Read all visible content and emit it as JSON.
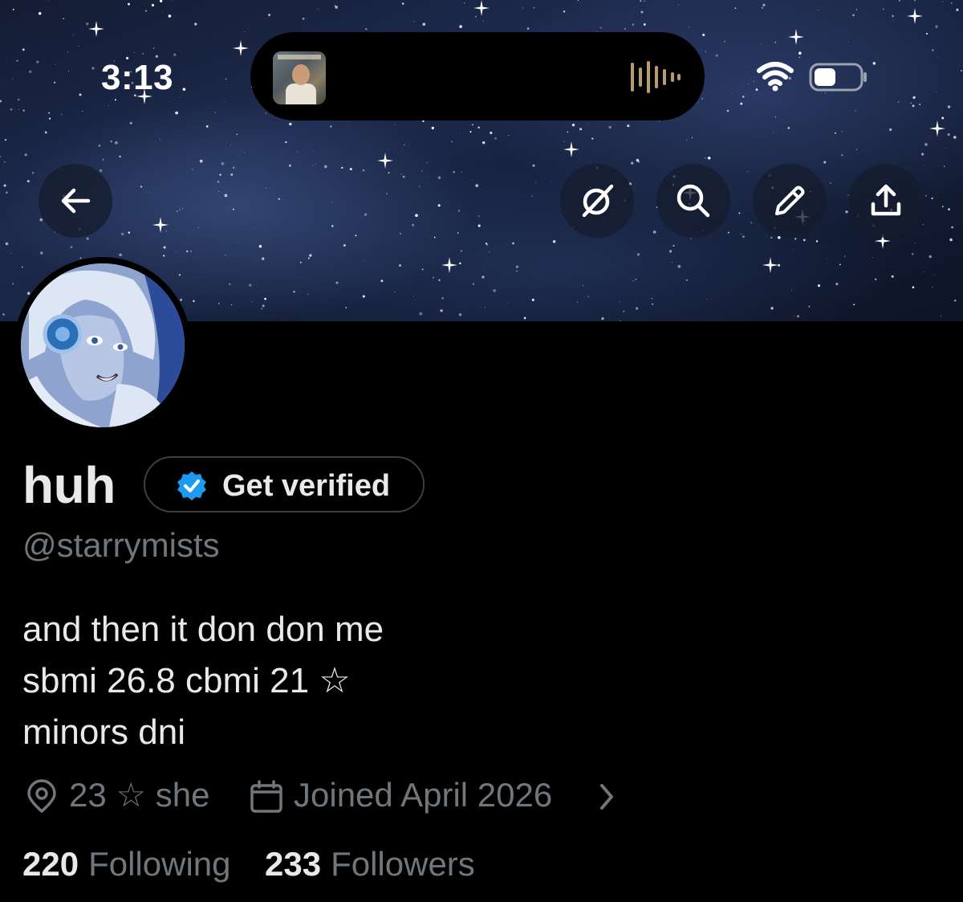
{
  "status_bar": {
    "time": "3:13",
    "now_playing_icon": "album-art-icon",
    "audio_icon": "waveform-icon",
    "wifi_icon": "wifi-icon",
    "battery_icon": "battery-icon"
  },
  "nav": {
    "back_icon": "back-arrow-icon",
    "actions": [
      {
        "name": "grok-icon"
      },
      {
        "name": "search-icon"
      },
      {
        "name": "edit-icon"
      },
      {
        "name": "share-icon"
      }
    ]
  },
  "profile": {
    "display_name": "huh",
    "verify_label": "Get verified",
    "handle": "@starrymists",
    "bio_lines": [
      "and then it don don me",
      "sbmi 26.8 cbmi 21 ☆",
      "minors dni"
    ],
    "location": "23 ☆ she",
    "joined": "Joined April 2026",
    "following_count": "220",
    "following_label": "Following",
    "followers_count": "233",
    "followers_label": "Followers"
  },
  "colors": {
    "background": "#000000",
    "primary_text": "#e7e9ea",
    "secondary_text": "#71767b",
    "verified_blue": "#1d9bf0"
  }
}
